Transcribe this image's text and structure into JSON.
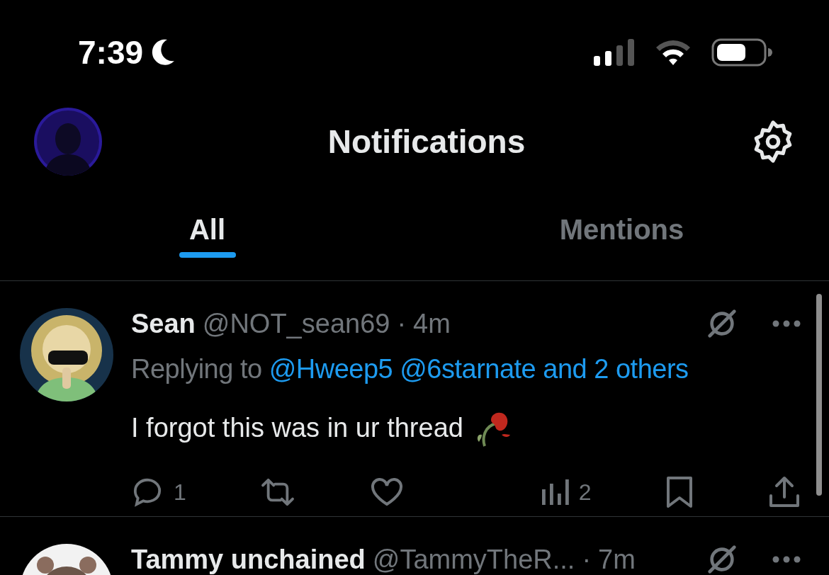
{
  "status_bar": {
    "time": "7:39"
  },
  "header": {
    "title": "Notifications"
  },
  "tabs": [
    {
      "label": "All",
      "selected": true
    },
    {
      "label": "Mentions",
      "selected": false
    }
  ],
  "posts": [
    {
      "name": "Sean",
      "handle": "@NOT_sean69",
      "dot": "·",
      "time": "4m",
      "replying_label": "Replying to",
      "reply_targets": "@Hweep5 @6starnate and 2 others",
      "text": "I forgot this was in ur thread",
      "actions": [
        {
          "kind": "reply",
          "count": "1"
        },
        {
          "kind": "repost"
        },
        {
          "kind": "like"
        },
        {
          "kind": "views",
          "count": "2"
        },
        {
          "kind": "bookmark"
        },
        {
          "kind": "share"
        }
      ]
    },
    {
      "name": "Tammy unchained",
      "handle": "@TammyTheR...",
      "dot": "·",
      "time": "7m"
    }
  ]
}
